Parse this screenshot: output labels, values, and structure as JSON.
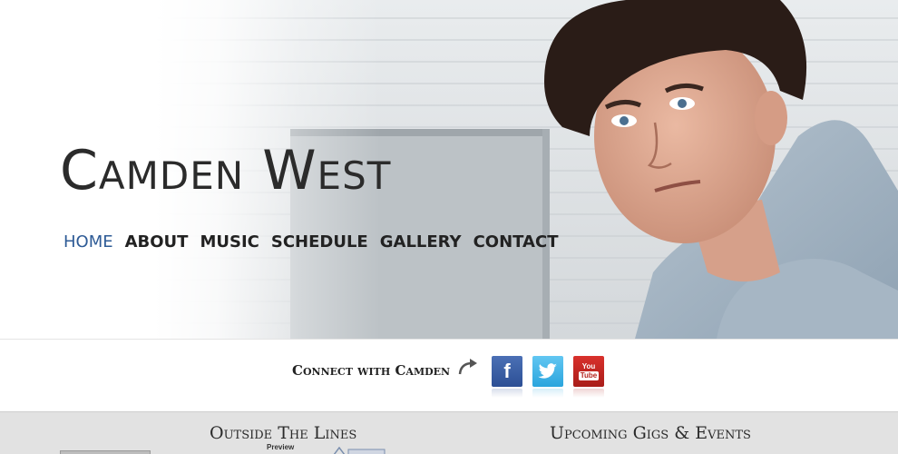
{
  "site": {
    "title": "Camden West"
  },
  "nav": {
    "items": [
      {
        "label": "HOME",
        "active": true
      },
      {
        "label": "ABOUT",
        "active": false
      },
      {
        "label": "MUSIC",
        "active": false
      },
      {
        "label": "SCHEDULE",
        "active": false
      },
      {
        "label": "GALLERY",
        "active": false
      },
      {
        "label": "CONTACT",
        "active": false
      }
    ]
  },
  "connect": {
    "label": "Connect with Camden",
    "facebook_glyph": "f",
    "youtube_top": "You",
    "youtube_bottom": "Tube"
  },
  "sections": {
    "album_heading": "Outside The Lines",
    "album_subtext": "Preview",
    "gigs_heading": "Upcoming Gigs & Events"
  },
  "colors": {
    "nav_active": "#2e5b96",
    "facebook": "#3b5998",
    "twitter": "#3cb3e8",
    "youtube": "#c4302b"
  },
  "icons": [
    "curved-arrow-icon",
    "facebook-icon",
    "twitter-icon",
    "youtube-icon"
  ]
}
